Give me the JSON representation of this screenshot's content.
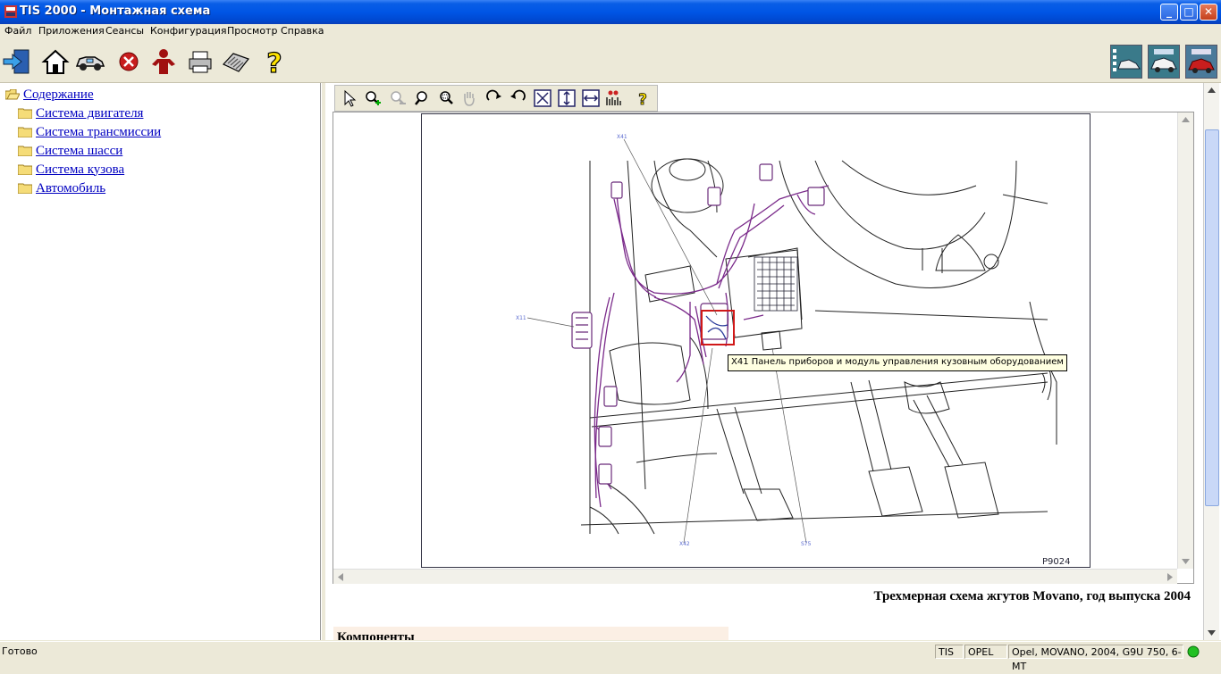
{
  "window": {
    "title": "TIS 2000 - Монтажная схема"
  },
  "menu": [
    "Файл",
    "Приложения",
    "Сеансы",
    "Конфигурация",
    "Просмотр",
    "Справка"
  ],
  "toolbar": {
    "icons": [
      "exit-icon",
      "home-icon",
      "vehicle-icon",
      "stop-icon",
      "user-icon",
      "print-icon",
      "keyboard-icon",
      "help-icon"
    ],
    "right_icons": [
      "sps-car-icon",
      "diagnostics-car-icon",
      "red-car-icon"
    ]
  },
  "tree": {
    "root": "Содержание",
    "items": [
      "Система двигателя",
      "Система трансмиссии",
      "Система шасси",
      "Система кузова",
      "Автомобиль"
    ]
  },
  "diagram": {
    "labels": {
      "x41": "X41",
      "x11": "X11",
      "x42": "X42",
      "s75": "S75"
    },
    "figure_id": "P9024",
    "tooltip": "X41 Панель приборов и модуль управления кузовным оборудованием",
    "caption": "Трехмерная схема жгутов Movano, год выпуска 2004",
    "section_heading": "Компоненты"
  },
  "status": {
    "left": "Готово",
    "seg1": "TIS",
    "seg2": "OPEL",
    "seg3": "Opel, MOVANO, 2004, G9U 750, 6-MT",
    "indicator_color": "#22c022"
  }
}
